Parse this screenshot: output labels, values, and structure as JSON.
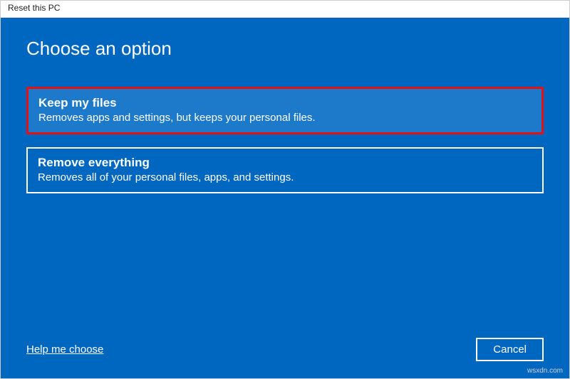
{
  "window": {
    "title": "Reset this PC"
  },
  "main": {
    "heading": "Choose an option",
    "options": [
      {
        "title": "Keep my files",
        "description": "Removes apps and settings, but keeps your personal files."
      },
      {
        "title": "Remove everything",
        "description": "Removes all of your personal files, apps, and settings."
      }
    ]
  },
  "footer": {
    "help_link": "Help me choose",
    "cancel_label": "Cancel"
  },
  "watermark": "wsxdn.com"
}
